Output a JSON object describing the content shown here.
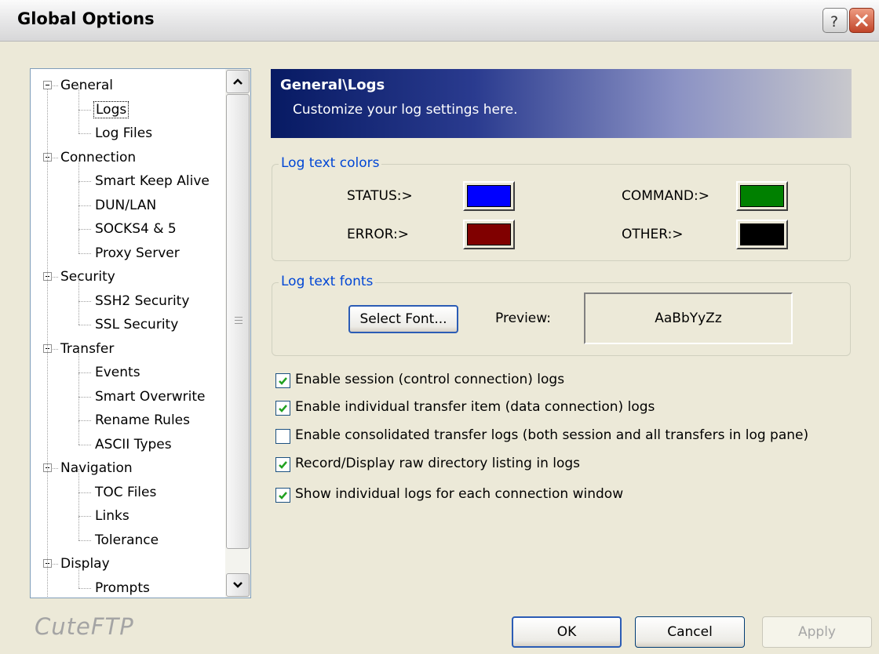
{
  "window": {
    "title": "Global Options"
  },
  "tree": {
    "items": [
      {
        "label": "General",
        "level": 0,
        "expanded": true
      },
      {
        "label": "Logs",
        "level": 1,
        "selected": true
      },
      {
        "label": "Log Files",
        "level": 1
      },
      {
        "label": "Connection",
        "level": 0,
        "expanded": true
      },
      {
        "label": "Smart Keep Alive",
        "level": 1
      },
      {
        "label": "DUN/LAN",
        "level": 1
      },
      {
        "label": "SOCKS4 & 5",
        "level": 1
      },
      {
        "label": "Proxy Server",
        "level": 1
      },
      {
        "label": "Security",
        "level": 0,
        "expanded": true
      },
      {
        "label": "SSH2 Security",
        "level": 1
      },
      {
        "label": "SSL Security",
        "level": 1
      },
      {
        "label": "Transfer",
        "level": 0,
        "expanded": true
      },
      {
        "label": "Events",
        "level": 1
      },
      {
        "label": "Smart Overwrite",
        "level": 1
      },
      {
        "label": "Rename Rules",
        "level": 1
      },
      {
        "label": "ASCII Types",
        "level": 1
      },
      {
        "label": "Navigation",
        "level": 0,
        "expanded": true
      },
      {
        "label": "TOC Files",
        "level": 1
      },
      {
        "label": "Links",
        "level": 1
      },
      {
        "label": "Tolerance",
        "level": 1
      },
      {
        "label": "Display",
        "level": 0,
        "expanded": true
      },
      {
        "label": "Prompts",
        "level": 1
      }
    ]
  },
  "header": {
    "title": "General\\Logs",
    "subtitle": "Customize your log settings here."
  },
  "colors_group": {
    "legend": "Log text colors",
    "status_label": "STATUS:>",
    "command_label": "COMMAND:>",
    "error_label": "ERROR:>",
    "other_label": "OTHER:>",
    "status_color": "#0000ff",
    "command_color": "#008000",
    "error_color": "#800000",
    "other_color": "#000000"
  },
  "fonts_group": {
    "legend": "Log text fonts",
    "select_font_label": "Select Font...",
    "preview_label": "Preview:",
    "preview_text": "AaBbYyZz"
  },
  "options": [
    {
      "label": "Enable session (control connection) logs",
      "checked": true
    },
    {
      "label": "Enable individual transfer item (data connection) logs",
      "checked": true
    },
    {
      "label": "Enable consolidated transfer logs (both session and all transfers in log pane)",
      "checked": false
    },
    {
      "label": "Record/Display raw directory listing in logs",
      "checked": true
    },
    {
      "label": "Show individual logs for each connection window",
      "checked": true
    }
  ],
  "buttons": {
    "ok": "OK",
    "cancel": "Cancel",
    "apply": "Apply"
  },
  "brand": "CuteFTP"
}
